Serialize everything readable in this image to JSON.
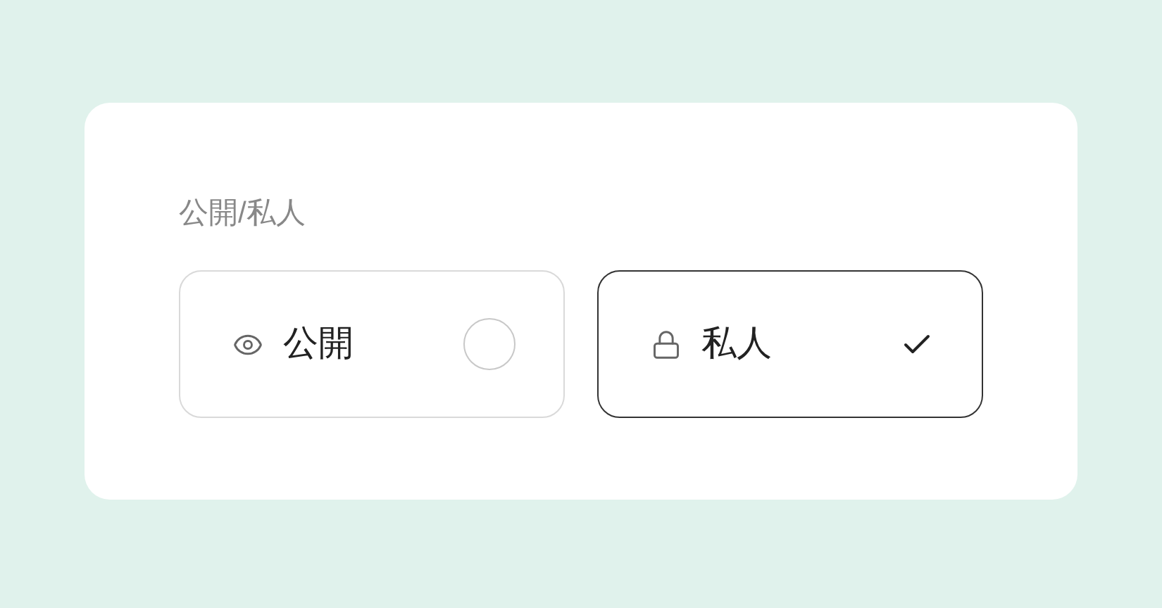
{
  "field": {
    "label": "公開/私人",
    "options": [
      {
        "kind": "public",
        "label": "公開",
        "selected": false
      },
      {
        "kind": "private",
        "label": "私人",
        "selected": true
      }
    ]
  }
}
